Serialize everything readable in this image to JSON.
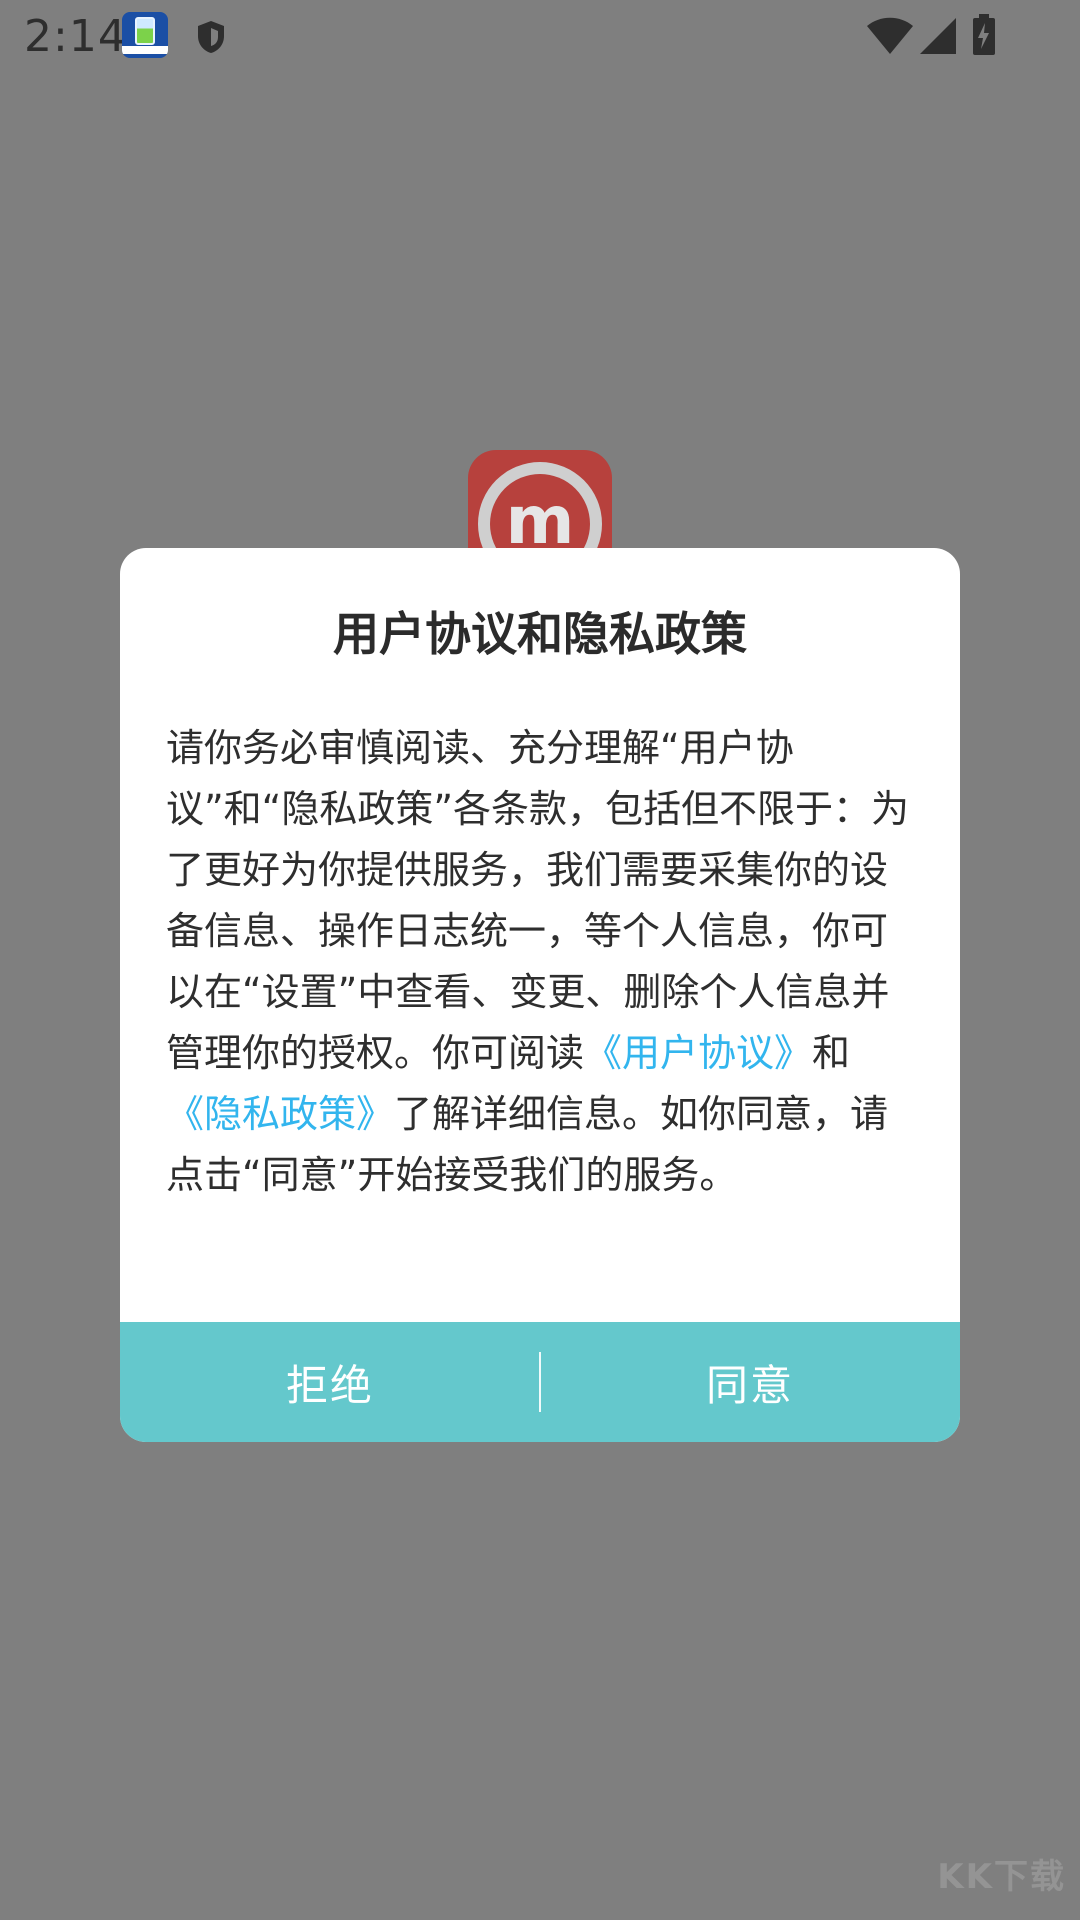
{
  "status_bar": {
    "time": "2:14"
  },
  "dialog": {
    "title": "用户协议和隐私政策",
    "body_part1": "请你务必审慎阅读、充分理解“用户协议”和“隐私政策”各条款，包括但不限于：为了更好为你提供服务，我们需要采集你的设备信息、操作日志统一，等个人信息，你可以在“设置”中查看、变更、删除个人信息并管理你的授权。你可阅读",
    "user_agreement_link": "《用户协议》",
    "connector": "和",
    "privacy_policy_link": "《隐私政策》",
    "body_part2": "了解详细信息。如你同意，请点击“同意”开始接受我们的服务。",
    "reject_label": "拒绝",
    "agree_label": "同意"
  },
  "colors": {
    "overlay": "#7f7f7f",
    "dialog_bg": "#ffffff",
    "button_bar": "#64c8cc",
    "link": "#32b5ee",
    "logo_red": "#b7413d"
  },
  "icons": {
    "status_app": "battery-app-icon",
    "shield": "shield-icon",
    "wifi": "wifi-icon",
    "signal": "cellular-signal-icon",
    "battery": "battery-charging-icon",
    "logo": "app-logo-icon"
  }
}
